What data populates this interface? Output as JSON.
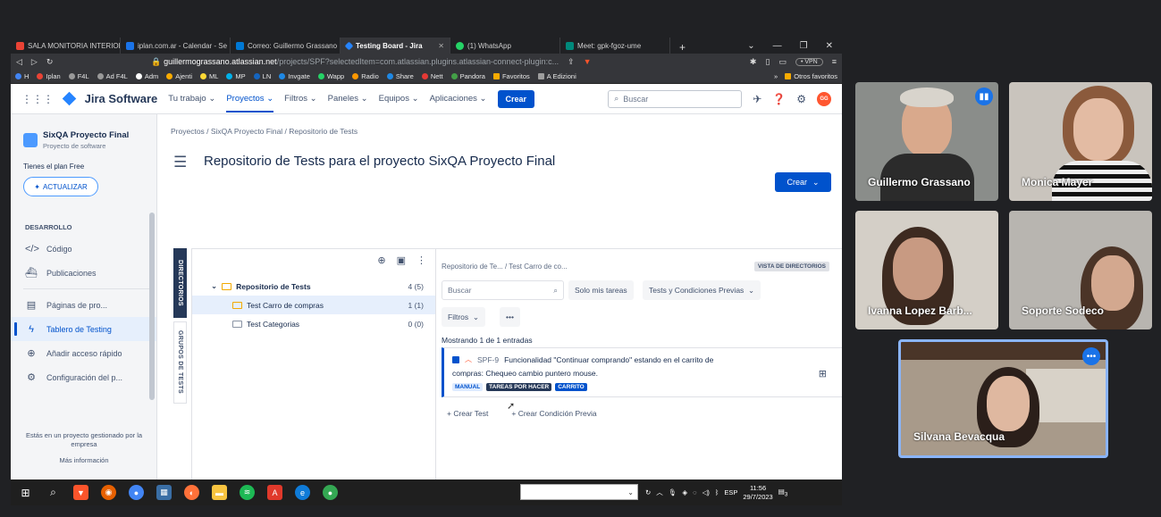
{
  "browser": {
    "tabs": [
      {
        "label": "SALA MONITORIA INTERIOR",
        "color": "#ea4335"
      },
      {
        "label": "iplan.com.ar - Calendar - Se",
        "color": "#1a73e8"
      },
      {
        "label": "Correo: Guillermo Grassano",
        "color": "#0078d4"
      },
      {
        "label": "Testing Board - Jira",
        "color": "#2684ff"
      },
      {
        "label": "(1) WhatsApp",
        "color": "#25d366"
      },
      {
        "label": "Meet: gpk-fgoz-ume",
        "color": "#00897b"
      }
    ],
    "url_host": "guillermograssano.atlassian.net",
    "url_path": "/projects/SPF?selectedItem=com.atlassian.plugins.atlassian-connect-plugin:c...",
    "vpn_label": "• VPN",
    "bookmarks": [
      "H",
      "Iplan",
      "F4L",
      "Ad F4L",
      "Adm",
      "Ajenti",
      "ML",
      "MP",
      "LN",
      "Invgate",
      "Wapp",
      "Radio",
      "Share",
      "Nett",
      "Pandora",
      "Favoritos",
      "A Edizioni"
    ],
    "bookmarks_right": "Otros favoritos"
  },
  "jira": {
    "app_name": "Jira Software",
    "nav": [
      "Tu trabajo",
      "Proyectos",
      "Filtros",
      "Paneles",
      "Equipos",
      "Aplicaciones"
    ],
    "create_label": "Crear",
    "search_placeholder": "Buscar",
    "avatar_initials": "GG"
  },
  "sidebar": {
    "project_name": "SixQA Proyecto Final",
    "project_type": "Proyecto de software",
    "plan_text": "Tienes el plan Free",
    "upgrade_label": "ACTUALIZAR",
    "section": "DESARROLLO",
    "items": [
      {
        "label": "Código",
        "icon": "</>"
      },
      {
        "label": "Publicaciones",
        "icon": "⛴"
      },
      {
        "label": "Páginas de pro...",
        "icon": "▤"
      },
      {
        "label": "Tablero de Testing",
        "icon": "ϟ"
      },
      {
        "label": "Añadir acceso rápido",
        "icon": "⊕"
      },
      {
        "label": "Configuración del p...",
        "icon": "⚙"
      }
    ],
    "footer_line1": "Estás en un proyecto gestionado por la",
    "footer_line2": "empresa",
    "footer_more": "Más información"
  },
  "main": {
    "breadcrumb": "Proyectos  /  SixQA Proyecto Final  /  Repositorio de Tests",
    "title": "Repositorio de Tests para el proyecto SixQA Proyecto Final",
    "create_label": "Crear",
    "vtab_directories": "DIRECTORIOS",
    "vtab_groups": "GRUPOS DE TESTS",
    "tree": [
      {
        "label": "Repositorio de Tests",
        "count": "4 (5)",
        "bold": true
      },
      {
        "label": "Test Carro de compras",
        "count": "1 (1)"
      },
      {
        "label": "Test Categorias",
        "count": "0 (0)"
      }
    ],
    "tests": {
      "breadcrumb": "Repositorio de Te...  /  Test Carro de co...",
      "view_badge": "VISTA DE DIRECTORIOS",
      "search_placeholder": "Buscar",
      "only_my_tasks": "Solo mis tareas",
      "tests_conditions": "Tests y Condiciones Previas",
      "filters": "Filtros",
      "more": "•••",
      "showing": "Mostrando 1 de 1 entradas",
      "card": {
        "key": "SPF-9",
        "summary_line1": "Funcionalidad \"Continuar comprando\" estando en el carrito de",
        "summary_line2": "compras: Chequeo cambio puntero mouse.",
        "tags": [
          "MANUAL",
          "TAREAS POR HACER",
          "CARRITO"
        ]
      },
      "create_test": "+ Crear Test",
      "create_precondition": "+ Crear Condición Previa"
    }
  },
  "taskbar": {
    "lang": "ESP",
    "time": "11:56",
    "date": "29/7/2023",
    "notif_count": "3"
  },
  "meet": {
    "participants": [
      {
        "name": "Guillermo Grassano",
        "bg": "#8a8d8a",
        "face": "#d9a98c",
        "hair": "#d8d4cc"
      },
      {
        "name": "Monica Mayer",
        "bg": "#c9c4bd",
        "face": "#e3bba3",
        "hair": "#8b5a3c"
      },
      {
        "name": "Ivanna Lopez Barb...",
        "bg": "#d4cfc7",
        "face": "#c89a82",
        "hair": "#3d2a20"
      },
      {
        "name": "Soporte Sodeco",
        "bg": "#b8b5b0",
        "face": "#d3a88f",
        "hair": "#4b3427"
      },
      {
        "name": "Silvana Bevacqua",
        "bg": "#a89a8a",
        "face": "#dfb8a0",
        "hair": "#2b1f1a"
      }
    ]
  }
}
